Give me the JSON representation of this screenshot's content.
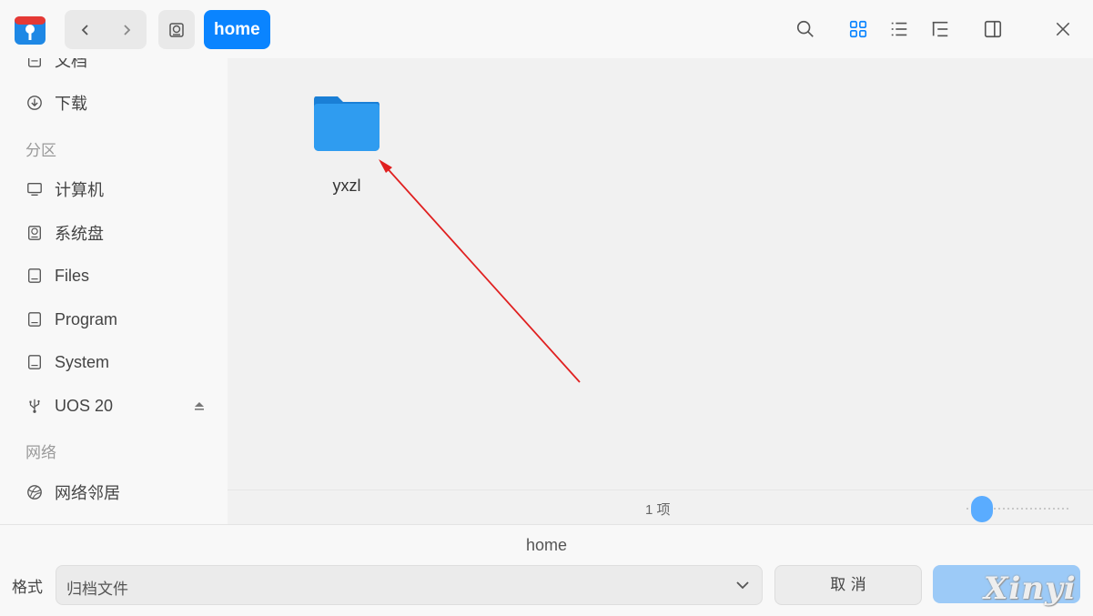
{
  "toolbar": {
    "breadcrumb_current": "home",
    "icons": [
      "app-logo-icon",
      "back-icon",
      "forward-icon",
      "disk-icon",
      "search-icon",
      "icon-view-icon",
      "list-view-icon",
      "tree-view-icon",
      "details-panel-icon",
      "close-icon"
    ]
  },
  "sidebar": {
    "items": [
      {
        "label": "文档",
        "icon": "document-icon"
      },
      {
        "label": "下载",
        "icon": "download-icon"
      },
      {
        "group": "分区"
      },
      {
        "label": "计算机",
        "icon": "computer-icon"
      },
      {
        "label": "系统盘",
        "icon": "system-disk-icon"
      },
      {
        "label": "Files",
        "icon": "drive-icon"
      },
      {
        "label": "Program",
        "icon": "drive-icon"
      },
      {
        "label": "System",
        "icon": "drive-icon"
      },
      {
        "label": "UOS 20",
        "icon": "usb-icon"
      },
      {
        "group": "网络"
      },
      {
        "label": "网络邻居",
        "icon": "network-icon"
      }
    ]
  },
  "content": {
    "items": [
      {
        "name": "yxzl",
        "type": "folder"
      }
    ]
  },
  "statusbar": {
    "count": "1 项",
    "zoom_level": 0.1
  },
  "savebar": {
    "filename": "home",
    "format_label": "格式",
    "format_value": "归档文件",
    "cancel_label": "取 消",
    "save_label": ""
  },
  "watermark": "Xinyi",
  "colors": {
    "accent": "#0a84ff",
    "folder": "#2a9bf0",
    "annotation_arrow": "#e02020"
  }
}
